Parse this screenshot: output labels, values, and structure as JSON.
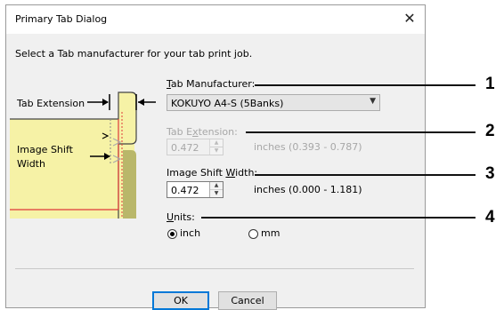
{
  "window": {
    "title": "Primary Tab Dialog",
    "close_glyph": "✕"
  },
  "instruction": "Select a Tab manufacturer for your tab print job.",
  "illustration": {
    "tab_extension_label": "Tab Extension",
    "image_shift_label_1": "Image Shift",
    "image_shift_label_2": "Width"
  },
  "tab_manufacturer": {
    "label_accel": "T",
    "label_rest": "ab Manufacturer:",
    "value": "KOKUYO A4-S (5Banks)"
  },
  "tab_extension": {
    "label_pre": "Tab E",
    "label_accel": "x",
    "label_rest": "tension:",
    "value": "0.472",
    "range": "inches (0.393 - 0.787)"
  },
  "image_shift_width": {
    "label_pre": "Image Shift ",
    "label_accel": "W",
    "label_rest": "idth:",
    "value": "0.472",
    "range": "inches (0.000 - 1.181)"
  },
  "units": {
    "label_accel": "U",
    "label_rest": "nits:",
    "options": [
      "inch",
      "mm"
    ],
    "selected": "inch"
  },
  "buttons": {
    "ok": "OK",
    "cancel": "Cancel"
  },
  "callouts": [
    "1",
    "2",
    "3",
    "4"
  ],
  "colors": {
    "tab_fill": "#f6f2a6",
    "tab_edge": "#e03a3a",
    "accent": "#0078d7"
  }
}
